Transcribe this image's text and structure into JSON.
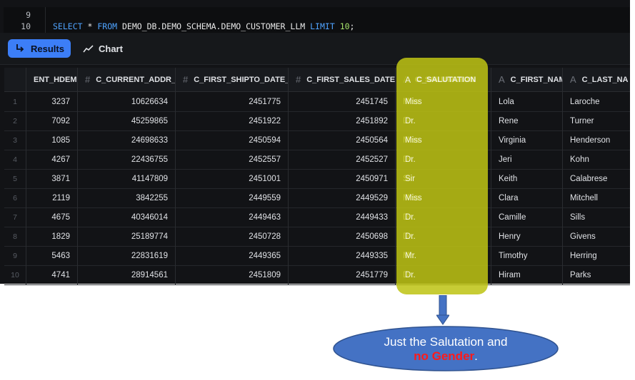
{
  "editor": {
    "lines": [
      {
        "number": "9"
      },
      {
        "number": "10",
        "tokens": [
          "SELECT",
          "*",
          "FROM",
          "DEMO_DB.DEMO_SCHEMA.DEMO_CUSTOMER_LLM",
          "LIMIT",
          "10",
          ";"
        ]
      }
    ]
  },
  "toolbar": {
    "results_label": "Results",
    "results_icon": "return-arrow-icon",
    "chart_label": "Chart",
    "chart_icon": "trend-line-icon",
    "accent": "#3c7ef7"
  },
  "table": {
    "columns": [
      {
        "label": "",
        "type": "rownum"
      },
      {
        "label": "ENT_HDEMO_:",
        "type": "number"
      },
      {
        "label": "C_CURRENT_ADDR_:",
        "type": "number",
        "icon": "#"
      },
      {
        "label": "C_FIRST_SHIPTO_DATE_",
        "type": "number",
        "icon": "#"
      },
      {
        "label": "C_FIRST_SALES_DATE_",
        "type": "number",
        "icon": "#"
      },
      {
        "label": "C_SALUTATION",
        "type": "text",
        "icon": "A"
      },
      {
        "label": "C_FIRST_NAM",
        "type": "text",
        "icon": "A"
      },
      {
        "label": "C_LAST_NA",
        "type": "text",
        "icon": "A"
      }
    ],
    "rows": [
      [
        "1",
        "3237",
        "10626634",
        "2451775",
        "2451745",
        "Miss",
        "Lola",
        "Laroche"
      ],
      [
        "2",
        "7092",
        "45259865",
        "2451922",
        "2451892",
        "Dr.",
        "Rene",
        "Turner"
      ],
      [
        "3",
        "1085",
        "24698633",
        "2450594",
        "2450564",
        "Miss",
        "Virginia",
        "Henderson"
      ],
      [
        "4",
        "4267",
        "22436755",
        "2452557",
        "2452527",
        "Dr.",
        "Jeri",
        "Kohn"
      ],
      [
        "5",
        "3871",
        "41147809",
        "2451001",
        "2450971",
        "Sir",
        "Keith",
        "Calabrese"
      ],
      [
        "6",
        "2119",
        "3842255",
        "2449559",
        "2449529",
        "Miss",
        "Clara",
        "Mitchell"
      ],
      [
        "7",
        "4675",
        "40346014",
        "2449463",
        "2449433",
        "Dr.",
        "Camille",
        "Sills"
      ],
      [
        "8",
        "1829",
        "25189774",
        "2450728",
        "2450698",
        "Dr.",
        "Henry",
        "Givens"
      ],
      [
        "9",
        "5463",
        "22831619",
        "2449365",
        "2449335",
        "Mr.",
        "Timothy",
        "Herring"
      ],
      [
        "10",
        "4741",
        "28914561",
        "2451809",
        "2451779",
        "Dr.",
        "Hiram",
        "Parks"
      ]
    ]
  },
  "annotation": {
    "text_part1": "Just the  Salutation and",
    "text_part2": "no Gender",
    "text_part3": ".",
    "highlight_color": "#bec414",
    "oval_color": "#4472c4",
    "emphasis_color": "#ff1a1a"
  }
}
